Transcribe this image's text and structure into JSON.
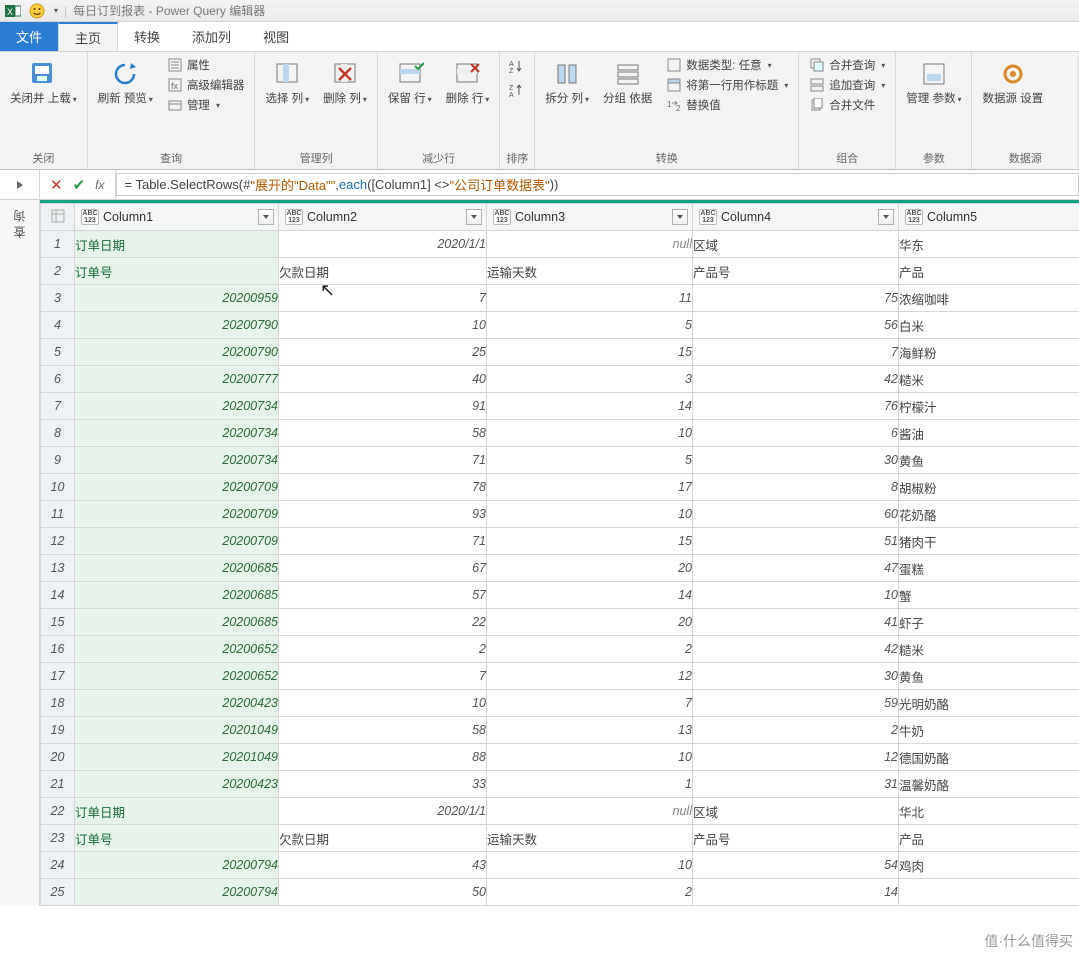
{
  "titlebar": {
    "file_name": "每日订到报表",
    "app_name": "Power Query 编辑器"
  },
  "tabs": {
    "file": "文件",
    "home": "主页",
    "transform": "转换",
    "addcol": "添加列",
    "view": "视图"
  },
  "ribbon": {
    "close": {
      "close_load": "关闭并\n上载",
      "group": "关闭"
    },
    "query": {
      "refresh": "刷新\n预览",
      "props": "属性",
      "adv": "高级编辑器",
      "manage": "管理",
      "group": "查询"
    },
    "managecols": {
      "choose": "选择\n列",
      "remove": "删除\n列",
      "group": "管理列"
    },
    "reducerows": {
      "keep": "保留\n行",
      "delete": "删除\n行",
      "group": "减少行"
    },
    "sort": {
      "group": "排序"
    },
    "transform": {
      "split": "拆分\n列",
      "groupby": "分组\n依据",
      "datatype": "数据类型: 任意",
      "firstrow": "将第一行用作标题",
      "replace": "替换值",
      "group": "转换"
    },
    "combine": {
      "merge": "合并查询",
      "append": "追加查询",
      "combinefiles": "合并文件",
      "group": "组合"
    },
    "params": {
      "manage": "管理\n参数",
      "group": "参数"
    },
    "datasource": {
      "settings": "数据源\n设置",
      "group": "数据源"
    }
  },
  "sidepanel": {
    "label": "查询"
  },
  "formula": {
    "fx": "fx",
    "text_pre": "= Table.SelectRows(#",
    "text_str1": "\"展开的\"Data\"\"",
    "text_mid": ", ",
    "text_kw": "each",
    "text_mid2": " ([Column1] <> ",
    "text_str2": "\"公司订单数据表\"",
    "text_end": "))"
  },
  "columns": [
    "Column1",
    "Column2",
    "Column3",
    "Column4",
    "Column5"
  ],
  "chart_data": {
    "type": "table",
    "columns": [
      "Column1",
      "Column2",
      "Column3",
      "Column4",
      "Column5"
    ],
    "rows": [
      [
        "订单日期",
        "2020/1/1",
        "null",
        "区域",
        "华东"
      ],
      [
        "订单号",
        "欠款日期",
        "运输天数",
        "产品号",
        "产品"
      ],
      [
        "20200959",
        "7",
        "11",
        "75",
        "浓缩咖啡"
      ],
      [
        "20200790",
        "10",
        "5",
        "56",
        "白米"
      ],
      [
        "20200790",
        "25",
        "15",
        "7",
        "海鲜粉"
      ],
      [
        "20200777",
        "40",
        "3",
        "42",
        "糙米"
      ],
      [
        "20200734",
        "91",
        "14",
        "76",
        "柠檬汁"
      ],
      [
        "20200734",
        "58",
        "10",
        "6",
        "酱油"
      ],
      [
        "20200734",
        "71",
        "5",
        "30",
        "黄鱼"
      ],
      [
        "20200709",
        "78",
        "17",
        "8",
        "胡椒粉"
      ],
      [
        "20200709",
        "93",
        "10",
        "60",
        "花奶酪"
      ],
      [
        "20200709",
        "71",
        "15",
        "51",
        "猪肉干"
      ],
      [
        "20200685",
        "67",
        "20",
        "47",
        "蛋糕"
      ],
      [
        "20200685",
        "57",
        "14",
        "10",
        "蟹"
      ],
      [
        "20200685",
        "22",
        "20",
        "41",
        "虾子"
      ],
      [
        "20200652",
        "2",
        "2",
        "42",
        "糙米"
      ],
      [
        "20200652",
        "7",
        "12",
        "30",
        "黄鱼"
      ],
      [
        "20200423",
        "10",
        "7",
        "59",
        "光明奶酪"
      ],
      [
        "20201049",
        "58",
        "13",
        "2",
        "牛奶"
      ],
      [
        "20201049",
        "88",
        "10",
        "12",
        "德国奶酪"
      ],
      [
        "20200423",
        "33",
        "1",
        "31",
        "温馨奶酪"
      ],
      [
        "订单日期",
        "2020/1/1",
        "null",
        "区域",
        "华北"
      ],
      [
        "订单号",
        "欠款日期",
        "运输天数",
        "产品号",
        "产品"
      ],
      [
        "20200794",
        "43",
        "10",
        "54",
        "鸡肉"
      ],
      [
        "20200794",
        "50",
        "2",
        "14",
        ""
      ]
    ],
    "row_types": [
      "h",
      "h",
      "d",
      "d",
      "d",
      "d",
      "d",
      "d",
      "d",
      "d",
      "d",
      "d",
      "d",
      "d",
      "d",
      "d",
      "d",
      "d",
      "d",
      "d",
      "d",
      "h",
      "h",
      "d",
      "d"
    ]
  },
  "watermark": "值·什么值得买"
}
